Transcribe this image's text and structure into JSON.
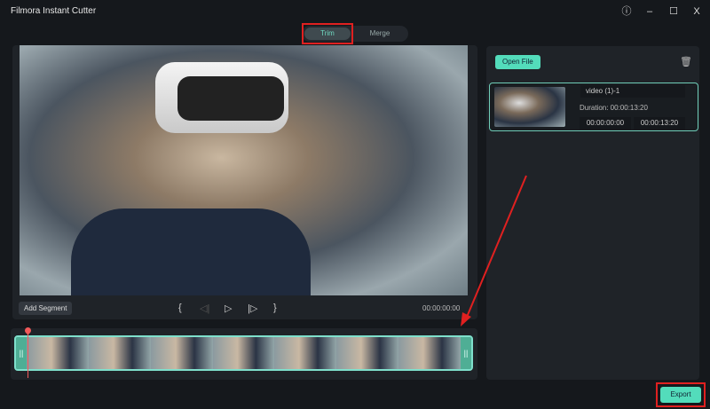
{
  "window": {
    "title": "Filmora Instant Cutter",
    "icons": [
      "help-icon",
      "minimize-icon",
      "maximize-icon",
      "close-icon"
    ]
  },
  "tabs": [
    {
      "label": "Trim",
      "active": true
    },
    {
      "label": "Merge",
      "active": false
    }
  ],
  "player": {
    "add_segment": "Add Segment",
    "timecode": "00:00:00:00"
  },
  "files": {
    "open_file": "Open File",
    "items": [
      {
        "name": "video (1)-1",
        "duration": "Duration: 00:00:13:20",
        "start": "00:00:00:00",
        "end": "00:00:13:20"
      }
    ]
  },
  "export": "Export",
  "colors": {
    "accent": "#53dcbb",
    "annotation": "#e02020",
    "background": "#15181c"
  }
}
